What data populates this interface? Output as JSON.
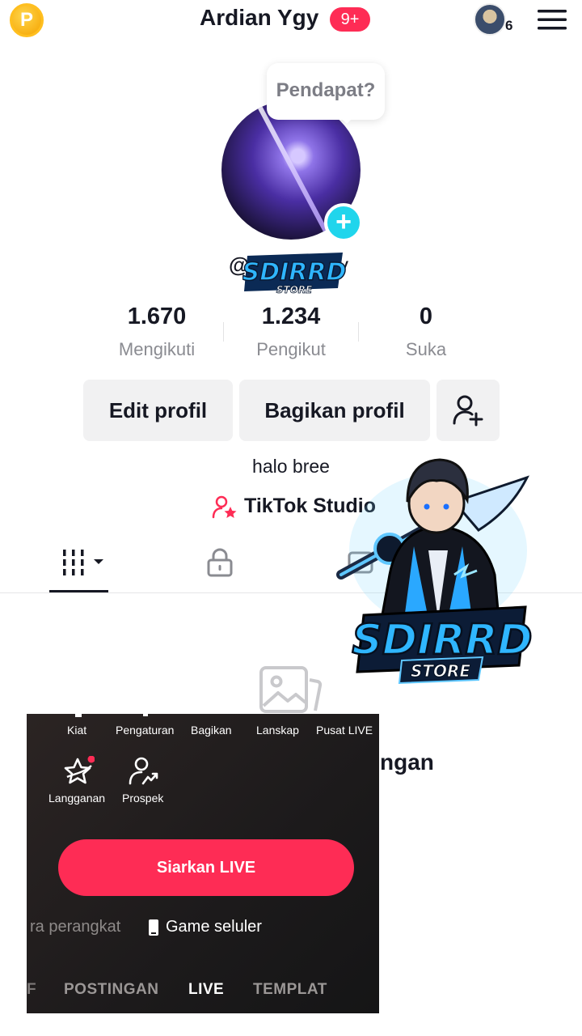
{
  "header": {
    "coin_letter": "P",
    "title": "Ardian Ygy",
    "badge": "9+",
    "avatar_count": "6"
  },
  "profile": {
    "tooltip": "Pendapat?",
    "username_prefix": "@",
    "username_suffix": "y",
    "logo_text": "SDIRRD",
    "logo_subtext": "STORE",
    "bio": "halo bree",
    "studio_link": "TikTok Studio"
  },
  "stats": [
    {
      "value": "1.670",
      "label": "Mengikuti"
    },
    {
      "value": "1.234",
      "label": "Pengikut"
    },
    {
      "value": "0",
      "label": "Suka"
    }
  ],
  "buttons": {
    "edit": "Edit profil",
    "share": "Bagikan profil"
  },
  "content": {
    "empty_text": "ngan"
  },
  "live_panel": {
    "top_items": [
      "Kiat",
      "Pengaturan",
      "Bagikan",
      "Lanskap",
      "Pusat LIVE"
    ],
    "items": [
      "Langganan",
      "Prospek"
    ],
    "live_button": "Siarkan LIVE",
    "modes": [
      "ra perangkat",
      "Game seluler"
    ],
    "tabs": [
      "F",
      "POSTINGAN",
      "LIVE",
      "TEMPLAT"
    ],
    "active_tab": "LIVE"
  },
  "sticker": {
    "text": "SDIRRD",
    "subtext": "STORE"
  },
  "colors": {
    "accent": "#fe2c55",
    "teal": "#20d5ec",
    "sticker_blue": "#1fa6ff"
  }
}
